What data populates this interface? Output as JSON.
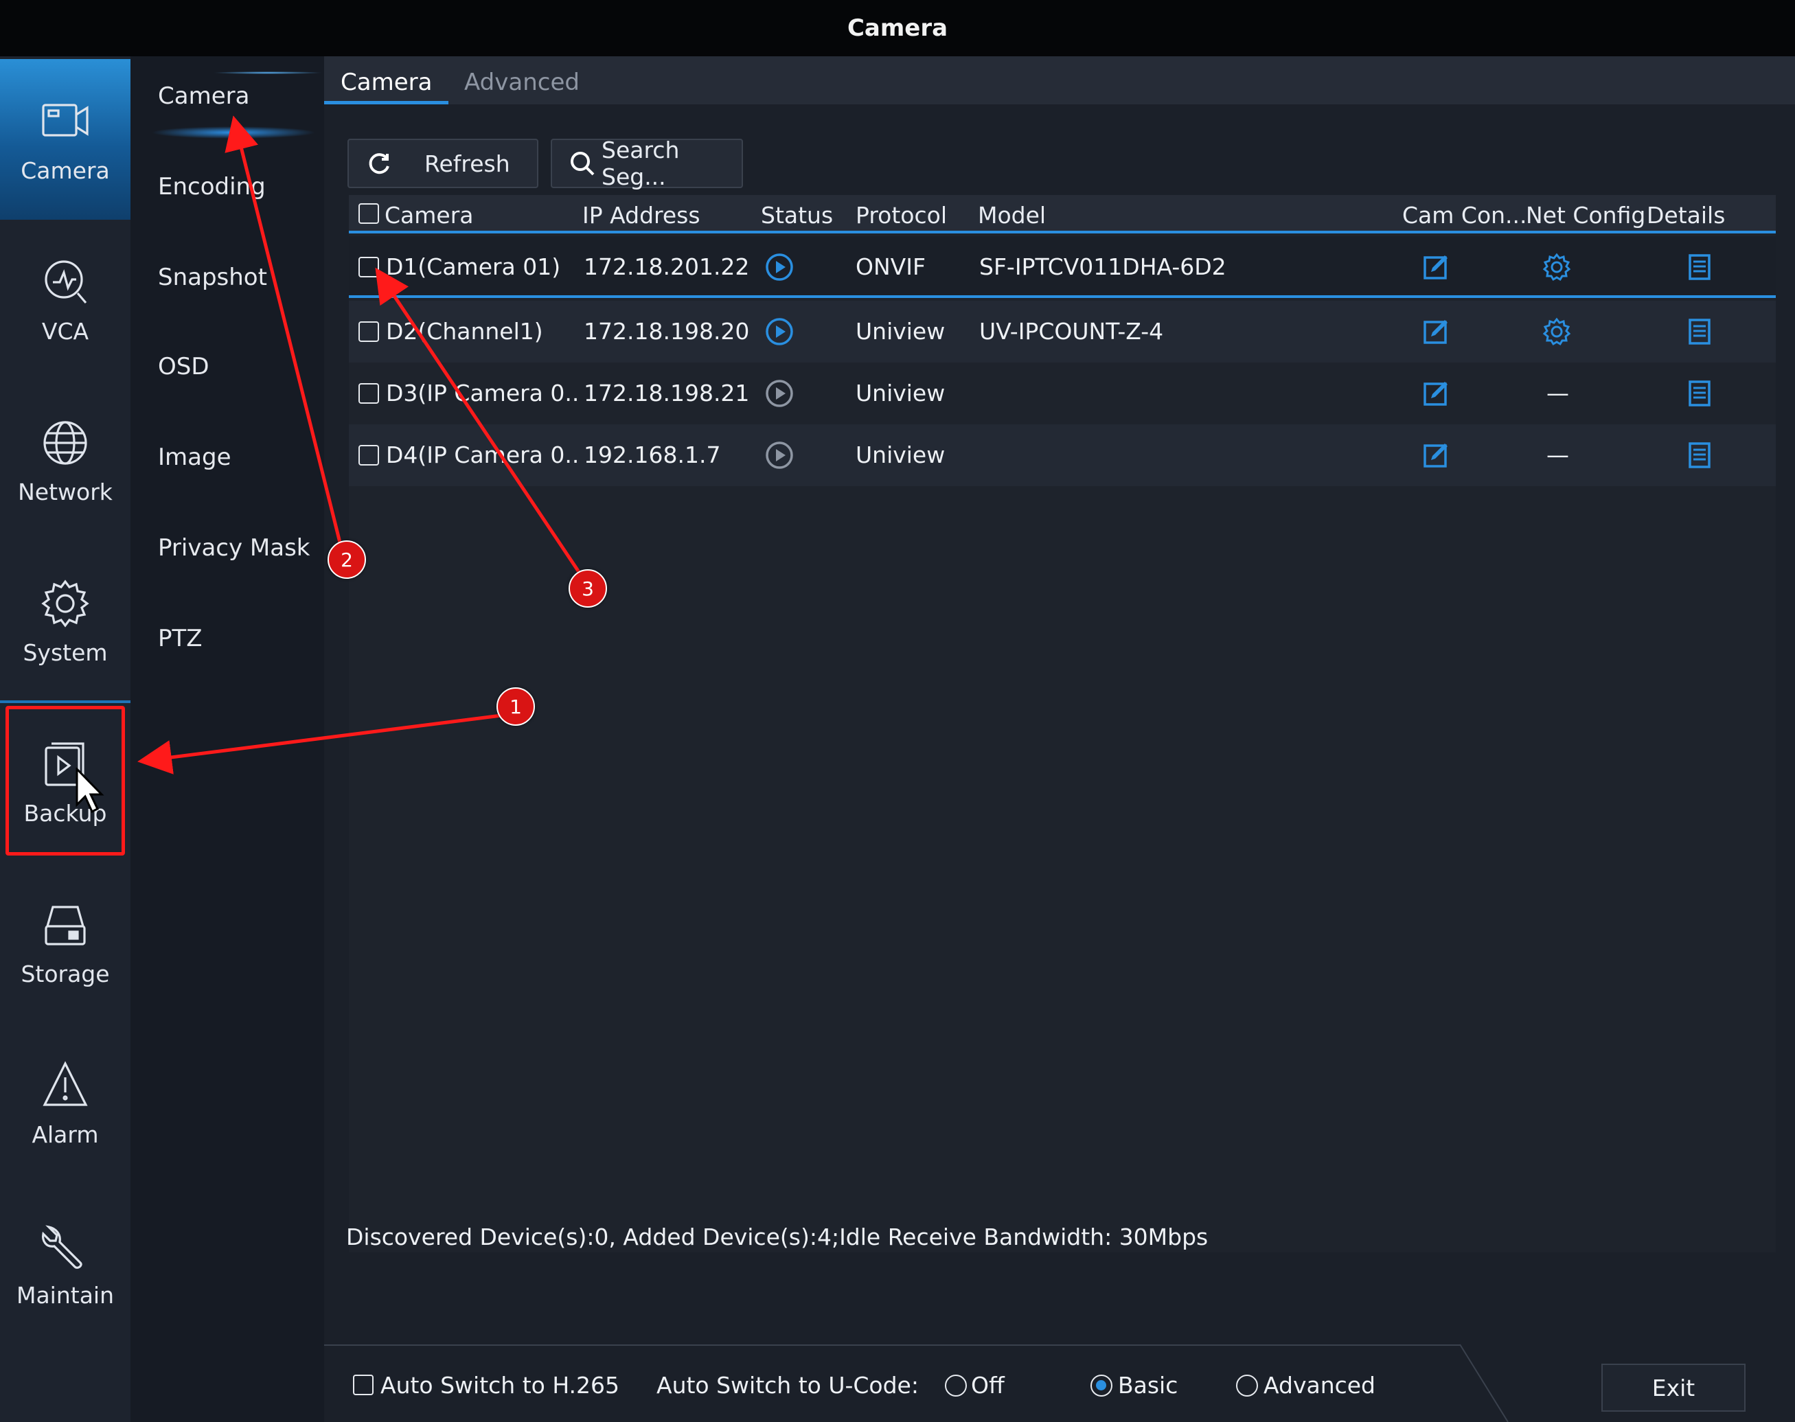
{
  "window": {
    "title": "Camera"
  },
  "rail": {
    "items": [
      {
        "label": "Camera",
        "icon": "camera-icon"
      },
      {
        "label": "VCA",
        "icon": "vca-icon"
      },
      {
        "label": "Network",
        "icon": "globe-icon"
      },
      {
        "label": "System",
        "icon": "gear-icon"
      },
      {
        "label": "Backup",
        "icon": "backup-icon"
      },
      {
        "label": "Storage",
        "icon": "storage-icon"
      },
      {
        "label": "Alarm",
        "icon": "alarm-icon"
      },
      {
        "label": "Maintain",
        "icon": "wrench-icon"
      }
    ]
  },
  "submenu": {
    "items": [
      "Camera",
      "Encoding",
      "Snapshot",
      "OSD",
      "Image",
      "Privacy Mask",
      "PTZ"
    ]
  },
  "tabs": [
    "Camera",
    "Advanced"
  ],
  "toolbar": {
    "refresh_label": "Refresh",
    "search_label": "Search Seg..."
  },
  "table": {
    "columns": [
      "Camera",
      "IP Address",
      "Status",
      "Protocol",
      "Model",
      "Cam Con...",
      "Net Config",
      "Details"
    ],
    "rows": [
      {
        "camera": "D1(Camera 01)",
        "ip": "172.18.201.22",
        "status": "online",
        "protocol": "ONVIF",
        "model": "SF-IPTCV011DHA-6D2",
        "net_config": "gear"
      },
      {
        "camera": "D2(Channel1)",
        "ip": "172.18.198.20",
        "status": "online",
        "protocol": "Uniview",
        "model": "UV-IPCOUNT-Z-4",
        "net_config": "gear"
      },
      {
        "camera": "D3(IP Camera 0..",
        "ip": "172.18.198.21",
        "status": "offline",
        "protocol": "Uniview",
        "model": "",
        "net_config": "—"
      },
      {
        "camera": "D4(IP Camera 0..",
        "ip": "192.168.1.7",
        "status": "offline",
        "protocol": "Uniview",
        "model": "",
        "net_config": "—"
      }
    ]
  },
  "status_text": "Discovered Device(s):0, Added Device(s):4;Idle Receive Bandwidth: 30Mbps",
  "bottom": {
    "auto_h265": "Auto Switch to H.265",
    "ucode_label": "Auto Switch to U-Code:",
    "options": [
      "Off",
      "Basic",
      "Advanced"
    ],
    "selected": "Basic",
    "exit_label": "Exit"
  },
  "annotations": [
    "1",
    "2",
    "3"
  ],
  "colors": {
    "accent": "#2a8fe0",
    "annotation": "#ff1a1a",
    "online": "#2a8fe0",
    "offline": "#8e96a3"
  }
}
